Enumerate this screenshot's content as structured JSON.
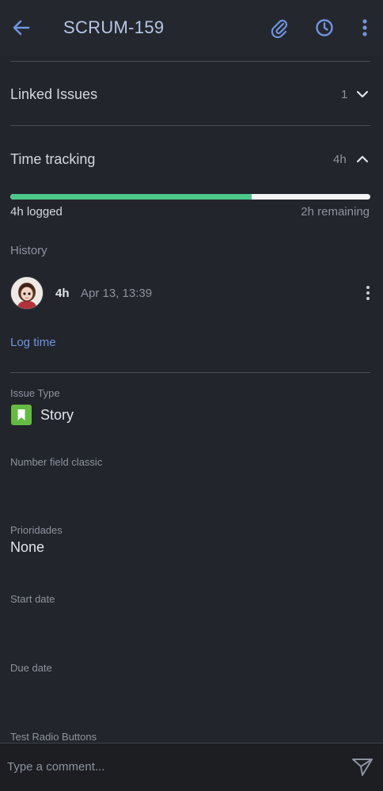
{
  "header": {
    "title": "SCRUM-159"
  },
  "linked_issues": {
    "label": "Linked Issues",
    "count": "1"
  },
  "time_tracking": {
    "label": "Time tracking",
    "total": "4h",
    "logged_label": "4h logged",
    "remaining_label": "2h remaining",
    "progress_fraction": 0.67,
    "history_label": "History",
    "history": [
      {
        "duration": "4h",
        "timestamp": "Apr 13, 13:39"
      }
    ],
    "log_time_label": "Log time"
  },
  "fields": {
    "issue_type_label": "Issue Type",
    "issue_type_value": "Story",
    "number_field_label": "Number field classic",
    "prioridades_label": "Prioridades",
    "prioridades_value": "None",
    "start_date_label": "Start date",
    "due_date_label": "Due date",
    "test_radio_label": "Test Radio Buttons"
  },
  "comment": {
    "placeholder": "Type a comment..."
  },
  "colors": {
    "accent": "#5b86d8",
    "progress": "#4cc98a",
    "story": "#65ba43"
  }
}
